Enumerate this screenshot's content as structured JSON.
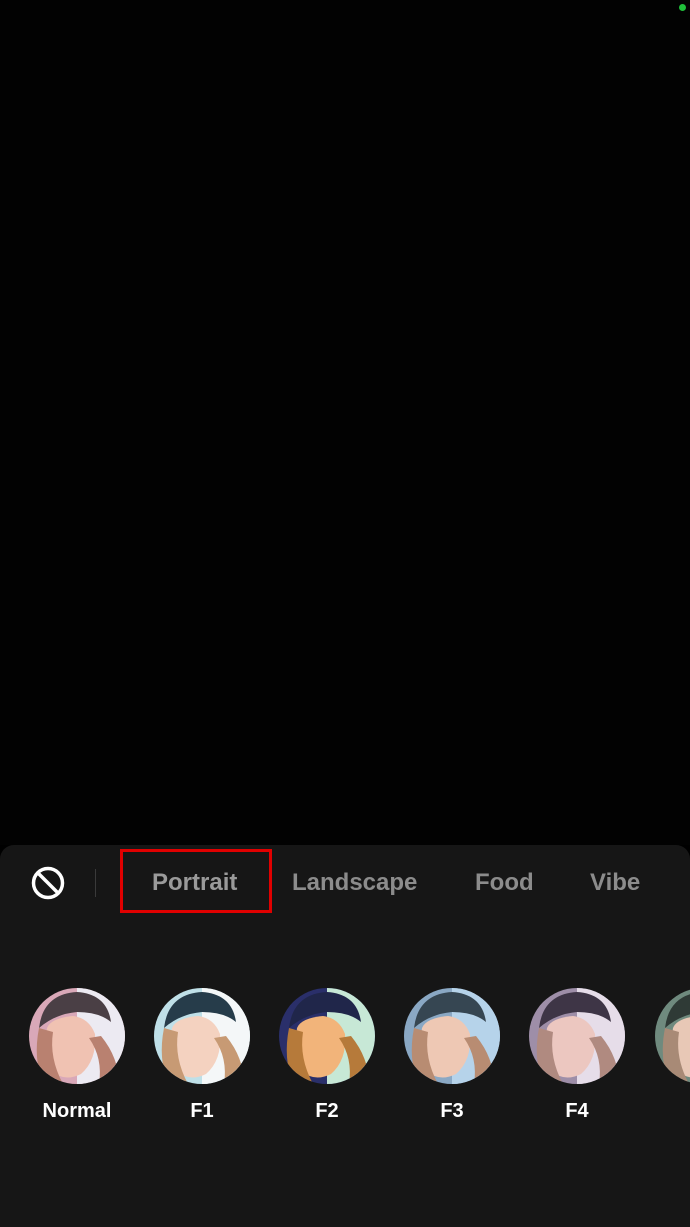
{
  "colors": {
    "preview_bg": "#020202",
    "panel_bg": "#161616",
    "status_dot": "#1fbf3a",
    "highlight": "#e00000",
    "tab_text": "#8c8c8c",
    "label_text": "#ffffff"
  },
  "toolbar": {
    "no_filter_icon": "no-filter-icon"
  },
  "tabs": [
    {
      "label": "Portrait",
      "selected": true
    },
    {
      "label": "Landscape",
      "selected": false
    },
    {
      "label": "Food",
      "selected": false
    },
    {
      "label": "Vibe",
      "selected": false
    }
  ],
  "filters": [
    {
      "label": "Normal",
      "tint": "#d9a8b8"
    },
    {
      "label": "F1",
      "tint": "#bfe0e8"
    },
    {
      "label": "F2",
      "tint": "#c7e8d6"
    },
    {
      "label": "F3",
      "tint": "#b6d3ea"
    },
    {
      "label": "F4",
      "tint": "#d8c8dc"
    },
    {
      "label": "",
      "tint": "#c9d6c7"
    }
  ]
}
